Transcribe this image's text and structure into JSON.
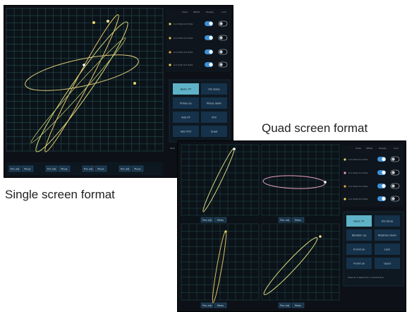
{
  "captions": {
    "single": "Single screen format",
    "quad": "Quad screen format"
  },
  "single_screen": {
    "column_headers": [
      "Scale",
      "Offset",
      "Display",
      "Lock"
    ],
    "channels": [
      {
        "value": "0.2 V/div  0.0 V/div",
        "display": true,
        "lock": false,
        "color": "#d8d86a"
      },
      {
        "value": "0.2 V/div  0.0 V/div",
        "display": true,
        "lock": false,
        "color": "#e6c35a"
      },
      {
        "value": "0.2 V/div  0.0 V/div",
        "display": true,
        "lock": false,
        "color": "#e8a94a"
      },
      {
        "value": "0.2 V/div  0.0 V/div",
        "display": true,
        "lock": false,
        "color": "#f0d45a"
      }
    ],
    "right_buttons": [
      "Basic XY",
      "I/Q setup",
      "Phase up",
      "Phase down",
      "Add XY",
      "XYZ",
      "Add XYZ",
      "Quad"
    ],
    "bottom_buttons": [
      "Pos adj",
      "Meas",
      "Pos adj",
      "Meas",
      "Pos adj",
      "Meas",
      "Pos adj",
      "Meas"
    ],
    "status_text": "Stop"
  },
  "quad_screen": {
    "column_headers": [
      "Scale",
      "Offset",
      "Display",
      "Lock"
    ],
    "channels": [
      {
        "value": "0.2 V/div  0.0 V/div",
        "display": true,
        "lock": false,
        "color": "#d8d86a"
      },
      {
        "value": "0.2 V/div  0.0 V/div",
        "display": true,
        "lock": false,
        "color": "#e8a0c8"
      },
      {
        "value": "0.2 V/div  0.0 V/div",
        "display": true,
        "lock": false,
        "color": "#e8a94a"
      },
      {
        "value": "0.2 V/div  0.0 V/div",
        "display": true,
        "lock": false,
        "color": "#f0d45a"
      }
    ],
    "right_buttons": [
      "Basic XY",
      "I/Q setup",
      "Rotation up",
      "Rotation down",
      "X-Grid on",
      "Lock",
      "Y-Grid on",
      "Quad"
    ],
    "info_text": "Press to create from current trace",
    "bottom_buttons": [
      "Pos adj",
      "Meas",
      "Pos adj",
      "Meas",
      "Pos adj",
      "Meas",
      "Pos adj",
      "Meas"
    ]
  },
  "colors": {
    "screen_bg": "#0d1117",
    "grid": "#2e6b6b",
    "button_active": "#5fb3c8",
    "button": "#16324a",
    "toggle_on": "#3d8fd6"
  }
}
